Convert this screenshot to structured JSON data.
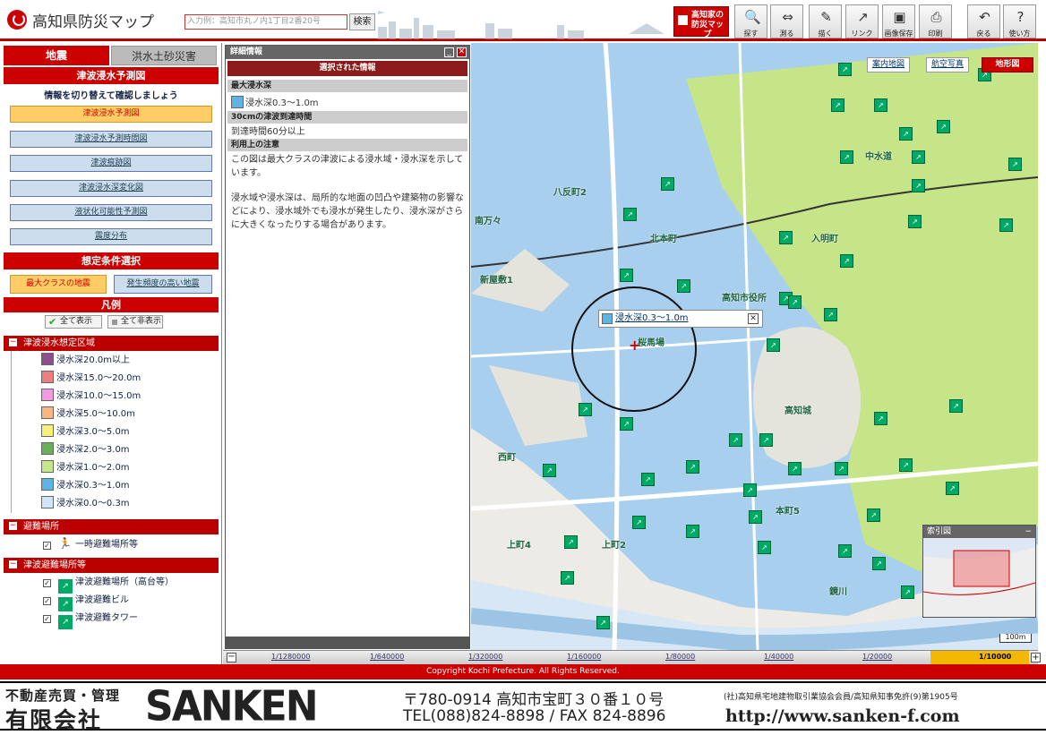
{
  "header": {
    "title": "高知県防災マップ",
    "search_placeholder": "入力例：高知市丸ノ内1丁目2番20号",
    "search_button": "検索",
    "home_button": "高知家の防災マップ",
    "tools": [
      {
        "label": "探す",
        "icon": "magnifier-icon"
      },
      {
        "label": "測る",
        "icon": "ruler-icon"
      },
      {
        "label": "描く",
        "icon": "pen-icon"
      },
      {
        "label": "リンク",
        "icon": "link-icon"
      },
      {
        "label": "画像保存",
        "icon": "save-icon"
      },
      {
        "label": "印刷",
        "icon": "printer-icon"
      },
      {
        "label": "戻る",
        "icon": "undo-icon"
      },
      {
        "label": "使い方",
        "icon": "help-icon"
      }
    ]
  },
  "left": {
    "tabs": [
      "地震",
      "洪水土砂災害"
    ],
    "section_title": "津波浸水予測図",
    "guide": "情報を切り替えて確認しましょう",
    "map_buttons": [
      "津波浸水予測図",
      "津波浸水予測時間図",
      "津波痕跡図",
      "津波浸水深変化図",
      "液状化可能性予測図",
      "震度分布"
    ],
    "cond_title": "想定条件選択",
    "cond_buttons": [
      "最大クラスの地震",
      "発生頻度の高い地震"
    ],
    "legend_title": "凡例",
    "show_all": "全て表示",
    "hide_all": "全て非表示",
    "tsunami_area_title": "津波浸水想定区域",
    "depths": [
      {
        "label": "浸水深20.0m以上",
        "color": "#8e4f8e"
      },
      {
        "label": "浸水深15.0〜20.0m",
        "color": "#e97f7f"
      },
      {
        "label": "浸水深10.0〜15.0m",
        "color": "#f29ae0"
      },
      {
        "label": "浸水深5.0〜10.0m",
        "color": "#f7b780"
      },
      {
        "label": "浸水深3.0〜5.0m",
        "color": "#f6f07a"
      },
      {
        "label": "浸水深2.0〜3.0m",
        "color": "#6ab05a"
      },
      {
        "label": "浸水深1.0〜2.0m",
        "color": "#c5e68a"
      },
      {
        "label": "浸水深0.3〜1.0m",
        "color": "#5fb4e6"
      },
      {
        "label": "浸水深0.0〜0.3m",
        "color": "#cfe6f8"
      }
    ],
    "evac_title": "避難場所",
    "evac_item": "一時避難場所等",
    "tsunami_evac_title": "津波避難場所等",
    "tsunami_evac_items": [
      "津波避難場所（高台等）",
      "津波避難ビル",
      "津波避難タワー"
    ]
  },
  "detail": {
    "title": "詳細情報",
    "selected": "選択された情報",
    "h_depth": "最大浸水深",
    "depth_value": "浸水深0.3〜1.0m",
    "h_arrival": "30cmの津波到達時間",
    "arrival_value": "到達時間60分以上",
    "h_notes": "利用上の注意",
    "note1": "この図は最大クラスの津波による浸水域・浸水深を示しています。",
    "note2": "浸水域や浸水深は、局所的な地面の凹凸や建築物の影響などにより、浸水域外でも浸水が発生したり、浸水深がさらに大きくなったりする場合があります。"
  },
  "map": {
    "layer_buttons": [
      "案内地図",
      "航空写真",
      "地形図"
    ],
    "popup_label": "浸水深0.3〜1.0m",
    "index_title": "索引図",
    "scale_label": "100m",
    "place_labels": [
      "中水道",
      "八反町2",
      "新屋敷1",
      "南万々",
      "桜馬場",
      "西町",
      "本町5",
      "上町2",
      "上町4",
      "入明町",
      "北本町",
      "高知市役所",
      "高知城",
      "鏡川"
    ],
    "scales": [
      "1/1280000",
      "1/640000",
      "1/320000",
      "1/160000",
      "1/80000",
      "1/40000",
      "1/20000",
      "1/10000"
    ],
    "active_scale": "1/10000"
  },
  "footer": {
    "copyright": "Copyright Kochi Prefecture. All Rights Reserved."
  },
  "ad": {
    "biz_type": "不動産売買・管理",
    "company": "有限会社",
    "brand": "SANKEN",
    "address": "〒780-0914  高知市宝町３０番１０号",
    "phone": "TEL(088)824-8898 / FAX 824-8896",
    "license": "(社)高知県宅地建物取引業協会会員/高知県知事免許(9)第1905号",
    "url": "http://www.sanken-f.com"
  }
}
